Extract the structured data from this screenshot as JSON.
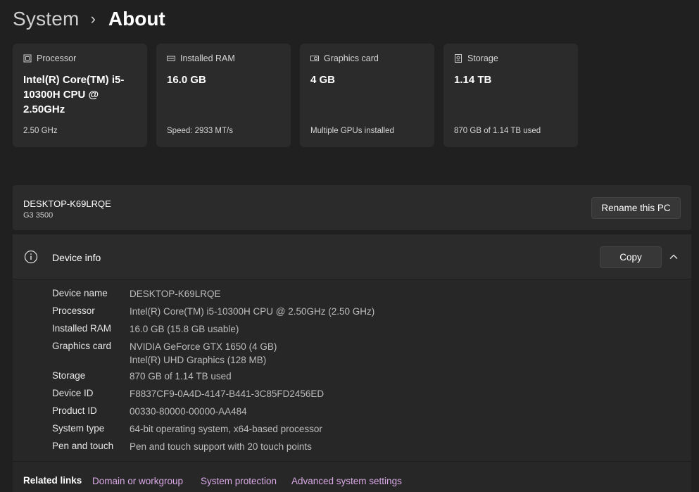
{
  "breadcrumb": {
    "parent": "System",
    "current": "About"
  },
  "cards": [
    {
      "icon": "processor-icon",
      "label": "Processor",
      "value": "Intel(R) Core(TM) i5-10300H CPU @ 2.50GHz",
      "sub": "2.50 GHz"
    },
    {
      "icon": "ram-icon",
      "label": "Installed RAM",
      "value": "16.0 GB",
      "sub": "Speed: 2933 MT/s"
    },
    {
      "icon": "graphics-card-icon",
      "label": "Graphics card",
      "value": "4 GB",
      "sub": "Multiple GPUs installed"
    },
    {
      "icon": "storage-icon",
      "label": "Storage",
      "value": "1.14 TB",
      "sub": "870 GB of 1.14 TB used"
    }
  ],
  "pc": {
    "name": "DESKTOP-K69LRQE",
    "model": "G3 3500",
    "rename_label": "Rename this PC"
  },
  "device_info": {
    "title": "Device info",
    "copy_label": "Copy",
    "rows": [
      {
        "key": "Device name",
        "value": "DESKTOP-K69LRQE"
      },
      {
        "key": "Processor",
        "value": "Intel(R) Core(TM) i5-10300H CPU @ 2.50GHz (2.50 GHz)"
      },
      {
        "key": "Installed RAM",
        "value": "16.0 GB (15.8 GB usable)"
      },
      {
        "key": "Graphics card",
        "value": "NVIDIA GeForce GTX 1650 (4 GB)",
        "value2": "Intel(R) UHD Graphics (128 MB)"
      },
      {
        "key": "Storage",
        "value": "870 GB of 1.14 TB used"
      },
      {
        "key": "Device ID",
        "value": "F8837CF9-0A4D-4147-B441-3C85FD2456ED"
      },
      {
        "key": "Product ID",
        "value": "00330-80000-00000-AA484"
      },
      {
        "key": "System type",
        "value": "64-bit operating system, x64-based processor"
      },
      {
        "key": "Pen and touch",
        "value": "Pen and touch support with 20 touch points"
      }
    ]
  },
  "related_links": {
    "title": "Related links",
    "links": [
      "Domain or workgroup",
      "System protection",
      "Advanced system settings"
    ]
  },
  "colors": {
    "background": "#202020",
    "card": "#2b2b2b",
    "link": "#d9a9e6"
  }
}
